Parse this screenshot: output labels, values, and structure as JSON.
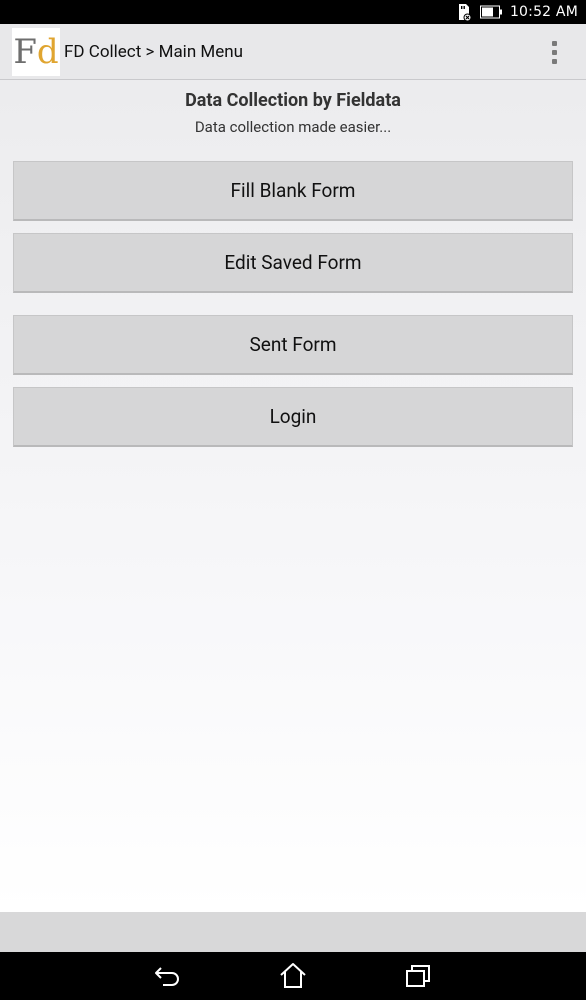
{
  "status_bar": {
    "time": "10:52 AM"
  },
  "app_bar": {
    "logo_letters": [
      "F",
      "d"
    ],
    "title": "FD Collect > Main Menu"
  },
  "header": {
    "title": "Data Collection by Fieldata",
    "subtitle": "Data collection made easier..."
  },
  "buttons": [
    {
      "label": "Fill Blank Form"
    },
    {
      "label": "Edit Saved Form"
    },
    {
      "label": "Sent Form"
    },
    {
      "label": "Login"
    }
  ],
  "colors": {
    "logo_f": "#6e6e6e",
    "logo_d": "#e0a530",
    "button_bg": "#d6d6d7"
  },
  "icons": [
    "sd-card-icon",
    "battery-icon",
    "overflow-menu-icon",
    "back-icon",
    "home-icon",
    "recent-apps-icon"
  ]
}
